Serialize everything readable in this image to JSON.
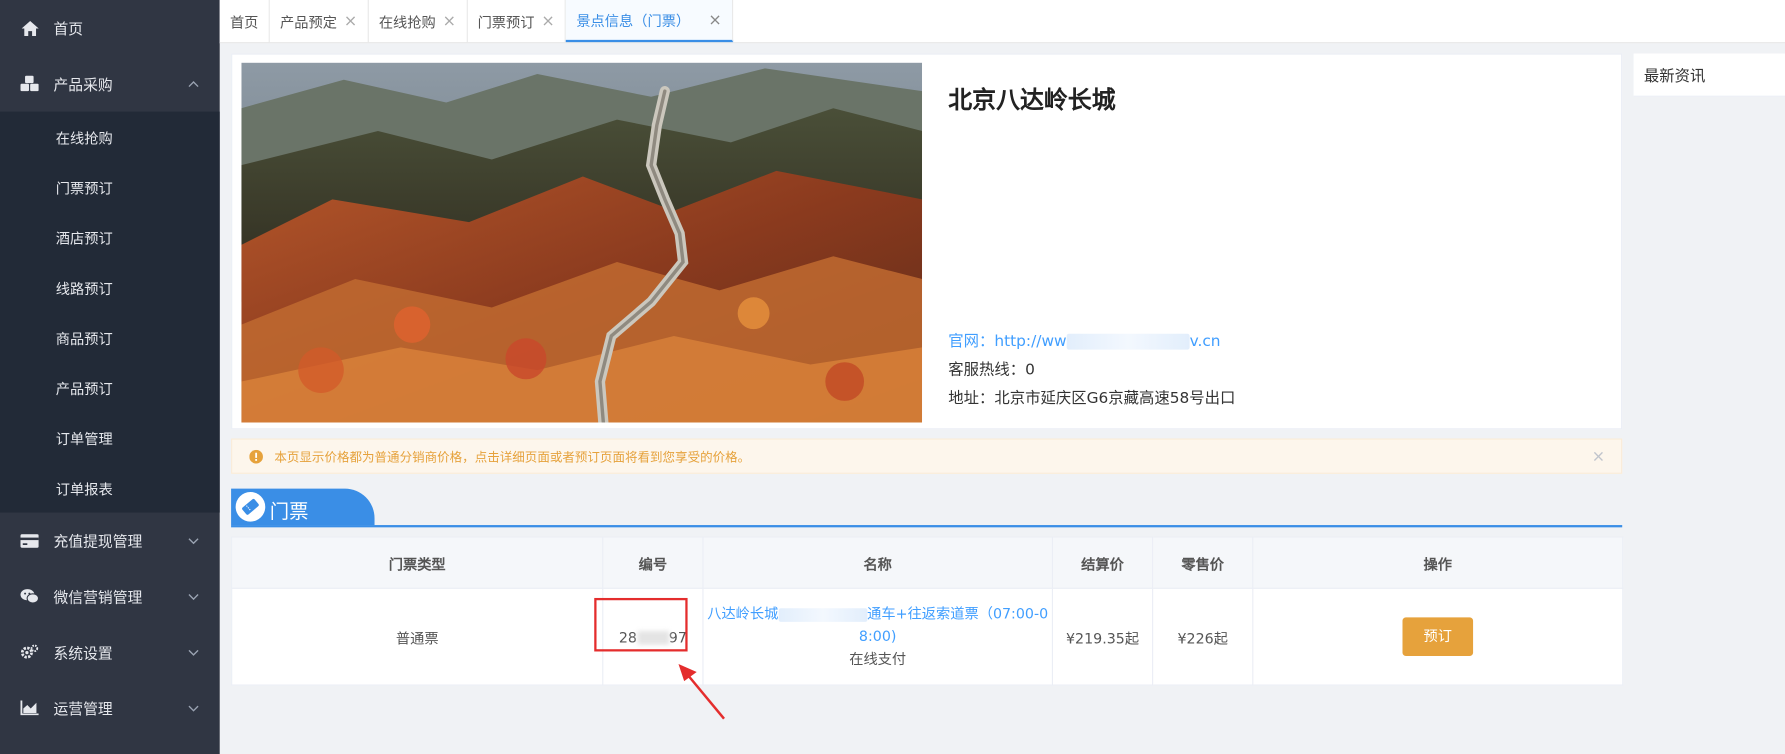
{
  "sidebar": {
    "top_items": [
      {
        "label": "首页",
        "icon": "home-icon"
      },
      {
        "label": "产品采购",
        "icon": "cubes-icon"
      }
    ],
    "sub_items": [
      "在线抢购",
      "门票预订",
      "酒店预订",
      "线路预订",
      "商品预订",
      "产品预订",
      "订单管理",
      "订单报表"
    ],
    "bottom_items": [
      {
        "label": "充值提现管理",
        "icon": "credit-card-icon"
      },
      {
        "label": "微信营销管理",
        "icon": "wechat-icon"
      },
      {
        "label": "系统设置",
        "icon": "gears-icon"
      },
      {
        "label": "运营管理",
        "icon": "area-chart-icon"
      }
    ]
  },
  "tabs": [
    {
      "label": "首页",
      "closable": false
    },
    {
      "label": "产品预定",
      "closable": true
    },
    {
      "label": "在线抢购",
      "closable": true
    },
    {
      "label": "门票预订",
      "closable": true
    },
    {
      "label": "景点信息（门票）",
      "closable": true,
      "active": true
    }
  ],
  "close_glyph": "×",
  "scenic": {
    "title": "北京八达岭长城",
    "website_label": "官网：",
    "website_start": "http://ww",
    "website_end": "v.cn",
    "hotline": "客服热线：0",
    "address": "地址：北京市延庆区G6京藏高速58号出口"
  },
  "news": {
    "title": "最新资讯"
  },
  "alert": {
    "text": "本页显示价格都为普通分销商价格，点击详细页面或者预订页面将看到您享受的价格。"
  },
  "section": {
    "title": "门票"
  },
  "table": {
    "headers": [
      "门票类型",
      "编号",
      "名称",
      "结算价",
      "零售价",
      "操作"
    ],
    "rows": [
      {
        "type": "普通票",
        "code_start": "28",
        "code_end": "97",
        "name_line1_start": "八达岭长城",
        "name_line1_end": "通车+往返索道票（07:00-0",
        "name_line2": "8:00)",
        "payment": "在线支付",
        "settle_price": "¥219.35起",
        "retail_price": "¥226起",
        "action": "预订"
      }
    ]
  },
  "colors": {
    "sidebar": "#303643",
    "submenu": "#222a37",
    "accent": "#3a8ee6",
    "warning": "#e6a23c",
    "danger": "#f56c6c"
  }
}
